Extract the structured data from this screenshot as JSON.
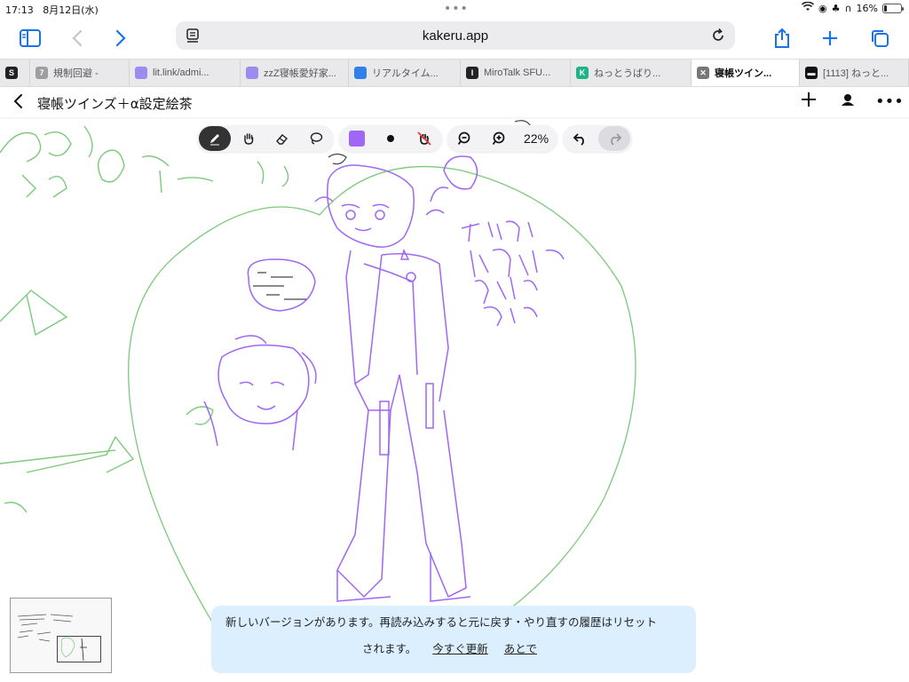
{
  "status": {
    "time": "17:13",
    "date": "8月12日(水)",
    "battery": "16%",
    "battery_level": 0.16
  },
  "browser": {
    "url": "kakeru.app",
    "tabs": [
      {
        "label": "",
        "favicon": "S",
        "favicon_color": "#222222"
      },
      {
        "label": "規制回避 -",
        "favicon": "7",
        "favicon_color": "#9e9e9e"
      },
      {
        "label": "lit.link/admi...",
        "favicon": "",
        "favicon_color": "#9b8cf0"
      },
      {
        "label": "zzZ寝帳愛好家...",
        "favicon": "",
        "favicon_color": "#9b8cf0"
      },
      {
        "label": "リアルタイム...",
        "favicon": "",
        "favicon_color": "#2f80ed"
      },
      {
        "label": "MiroTalk SFU...",
        "favicon": "I",
        "favicon_color": "#222222"
      },
      {
        "label": "ねっとうばり...",
        "favicon": "K",
        "favicon_color": "#1fb38a"
      },
      {
        "label": "寝帳ツイン...",
        "favicon": "✕",
        "favicon_color": "#777777"
      },
      {
        "label": "[1113] ねっと...",
        "favicon": "▬",
        "favicon_color": "#111111"
      }
    ],
    "active_tab": 7
  },
  "app": {
    "title": "寝帳ツインズ＋α設定絵茶",
    "zoom": "22%",
    "pen_color": "#a066f5"
  },
  "banner": {
    "message": "新しいバージョンがあります。再読み込みすると元に戻す・やり直すの履歴はリセット",
    "message_cont": "されます。",
    "update_now": "今すぐ更新",
    "later": "あとで"
  }
}
